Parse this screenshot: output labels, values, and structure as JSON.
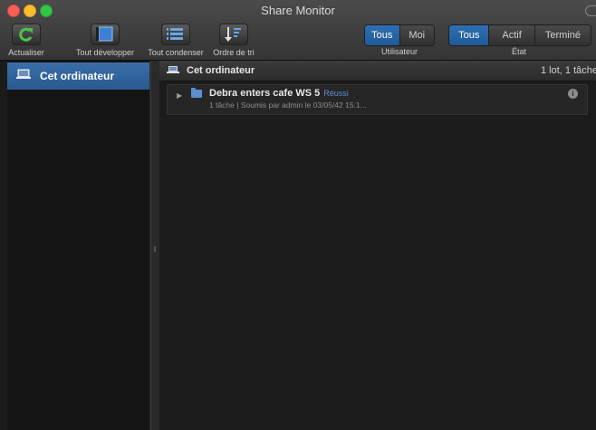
{
  "window": {
    "title": "Share Monitor"
  },
  "toolbar": {
    "refresh_label": "Actualiser",
    "expand_all_label": "Tout développer",
    "collapse_all_label": "Tout condenser",
    "sort_order_label": "Ordre de tri"
  },
  "filters": {
    "user": {
      "label": "Utilisateur",
      "options": [
        "Tous",
        "Moi"
      ],
      "selected": "Tous"
    },
    "state": {
      "label": "État",
      "options": [
        "Tous",
        "Actif",
        "Terminé"
      ],
      "selected": "Tous"
    }
  },
  "sidebar": {
    "items": [
      {
        "label": "Cet ordinateur",
        "selected": true
      }
    ]
  },
  "main": {
    "header_title": "Cet ordinateur",
    "header_count": "1 lot, 1 tâche",
    "jobs": [
      {
        "name": "Debra enters cafe WS 5",
        "status": "Réussi",
        "details": "1 tâche  |  Soumis par admin le 03/05/42 15:1..."
      }
    ]
  },
  "colors": {
    "accent": "#2f6fb2",
    "status": "#5e8fd0",
    "background": "#1b1b1b"
  }
}
